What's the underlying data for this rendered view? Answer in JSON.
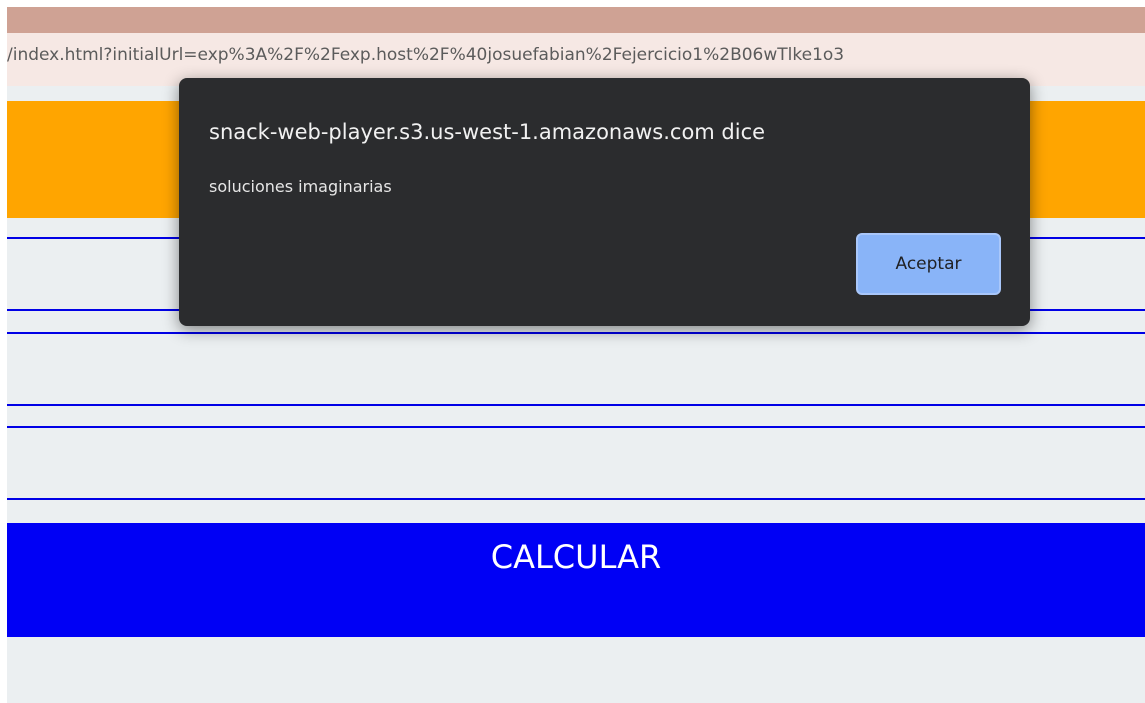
{
  "browser": {
    "address_text": "/index.html?initialUrl=exp%3A%2F%2Fexp.host%2F%40josuefabian%2Fejercicio1%2B06wTlke1o3"
  },
  "app": {
    "calculate_label": "CALCULAR"
  },
  "dialog": {
    "title": "snack-web-player.s3.us-west-1.amazonaws.com dice",
    "message": "soluciones imaginarias",
    "ok_label": "Aceptar"
  },
  "colors": {
    "header": "#ffa500",
    "button": "#0000f5",
    "field_border": "#0000e6",
    "background": "#ebeff1",
    "dialog_bg": "#2b2c2e",
    "dialog_button": "#89b4f8"
  }
}
